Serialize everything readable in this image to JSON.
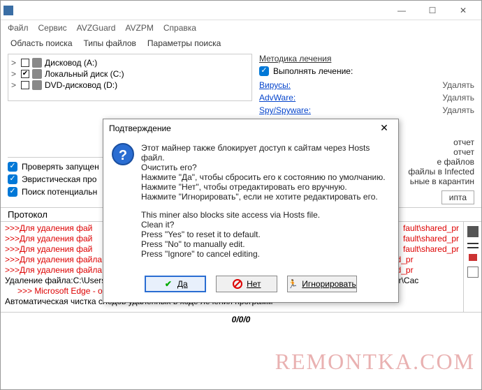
{
  "titlebar": {
    "min": "—",
    "max": "☐",
    "close": "✕"
  },
  "menubar": {
    "items": [
      "Файл",
      "Сервис",
      "AVZGuard",
      "AVZPM",
      "Справка"
    ]
  },
  "tabs": {
    "items": [
      "Область поиска",
      "Типы файлов",
      "Параметры поиска"
    ]
  },
  "tree": {
    "items": [
      {
        "arrow": ">",
        "checked": false,
        "label": "Дисковод (A:)"
      },
      {
        "arrow": ">",
        "checked": true,
        "label": "Локальный диск (C:)"
      },
      {
        "arrow": ">",
        "checked": false,
        "label": "DVD-дисковод (D:)"
      }
    ]
  },
  "checks": {
    "items": [
      "Проверять запущен",
      "Эвристическая про",
      "Поиск потенциальн"
    ]
  },
  "right": {
    "section": "Методика лечения",
    "execute": "Выполнять лечение:",
    "actions": [
      {
        "link": "Вирусы:",
        "value": "Удалять"
      },
      {
        "link": "AdvWare:",
        "value": "Удалять"
      },
      {
        "link": "Spy/Spyware:",
        "value": "Удалять"
      }
    ],
    "extra_lines": [
      "отчет",
      "отчет",
      "е файлов",
      "файлы в  Infected",
      "ьные в  карантин"
    ],
    "script_btn": "ипта"
  },
  "protocol_label": "Протокол",
  "log": {
    "lines": [
      {
        "cls": "red",
        "text": ">>>Для удаления фай"
      },
      {
        "cls": "red",
        "text": ">>>Для удаления фай"
      },
      {
        "cls": "red",
        "text": ">>>Для удаления фай"
      },
      {
        "cls": "red",
        "text": ">>>Для удаления файла C:\\Users\\remontka.pro\\AppData\\Local\\Microsoft\\Edge\\User Data\\Default\\shared_pr"
      },
      {
        "cls": "red",
        "text": ">>>Для удаления файла C:\\Users\\remontka.pro\\AppData\\Local\\Microsoft\\Edge\\User Data\\Default\\shared_pr"
      },
      {
        "cls": "",
        "text": "Удаление файла:C:\\Users\\remontka.pro\\AppData\\Local\\Microsoft\\Edge\\User Data\\Default\\Service Worker\\Cac"
      },
      {
        "cls": "redspace",
        "text": ">>>  Microsoft Edge - очистка кеша - исправлено"
      },
      {
        "cls": "",
        "text": "Автоматическая чистка следов удаленных в ходе лечения программ"
      }
    ],
    "tail_right": [
      "fault\\shared_pr",
      "fault\\shared_pr",
      "fault\\shared_pr"
    ]
  },
  "status": "0/0/0",
  "watermark": "REMONTKA.COM",
  "dialog": {
    "title": "Подтверждение",
    "close": "✕",
    "icon": "?",
    "ru": [
      "Этот майнер также блокирует доступ к сайтам через Hosts файл.",
      "Очистить его?",
      "Нажмите \"Да\", чтобы сбросить его к состоянию по умолчанию.",
      "Нажмите \"Нет\", чтобы отредактировать его вручную.",
      "Нажмите \"Игнорировать\", если не хотите редактировать его."
    ],
    "en": [
      "This miner also blocks site access via Hosts file.",
      "Clean it?",
      "Press \"Yes\" to reset it to default.",
      "Press \"No\" to manually edit.",
      "Press \"Ignore\" to cancel editing."
    ],
    "buttons": {
      "yes": "Да",
      "no": "Нет",
      "ignore": "Игнорировать"
    }
  }
}
